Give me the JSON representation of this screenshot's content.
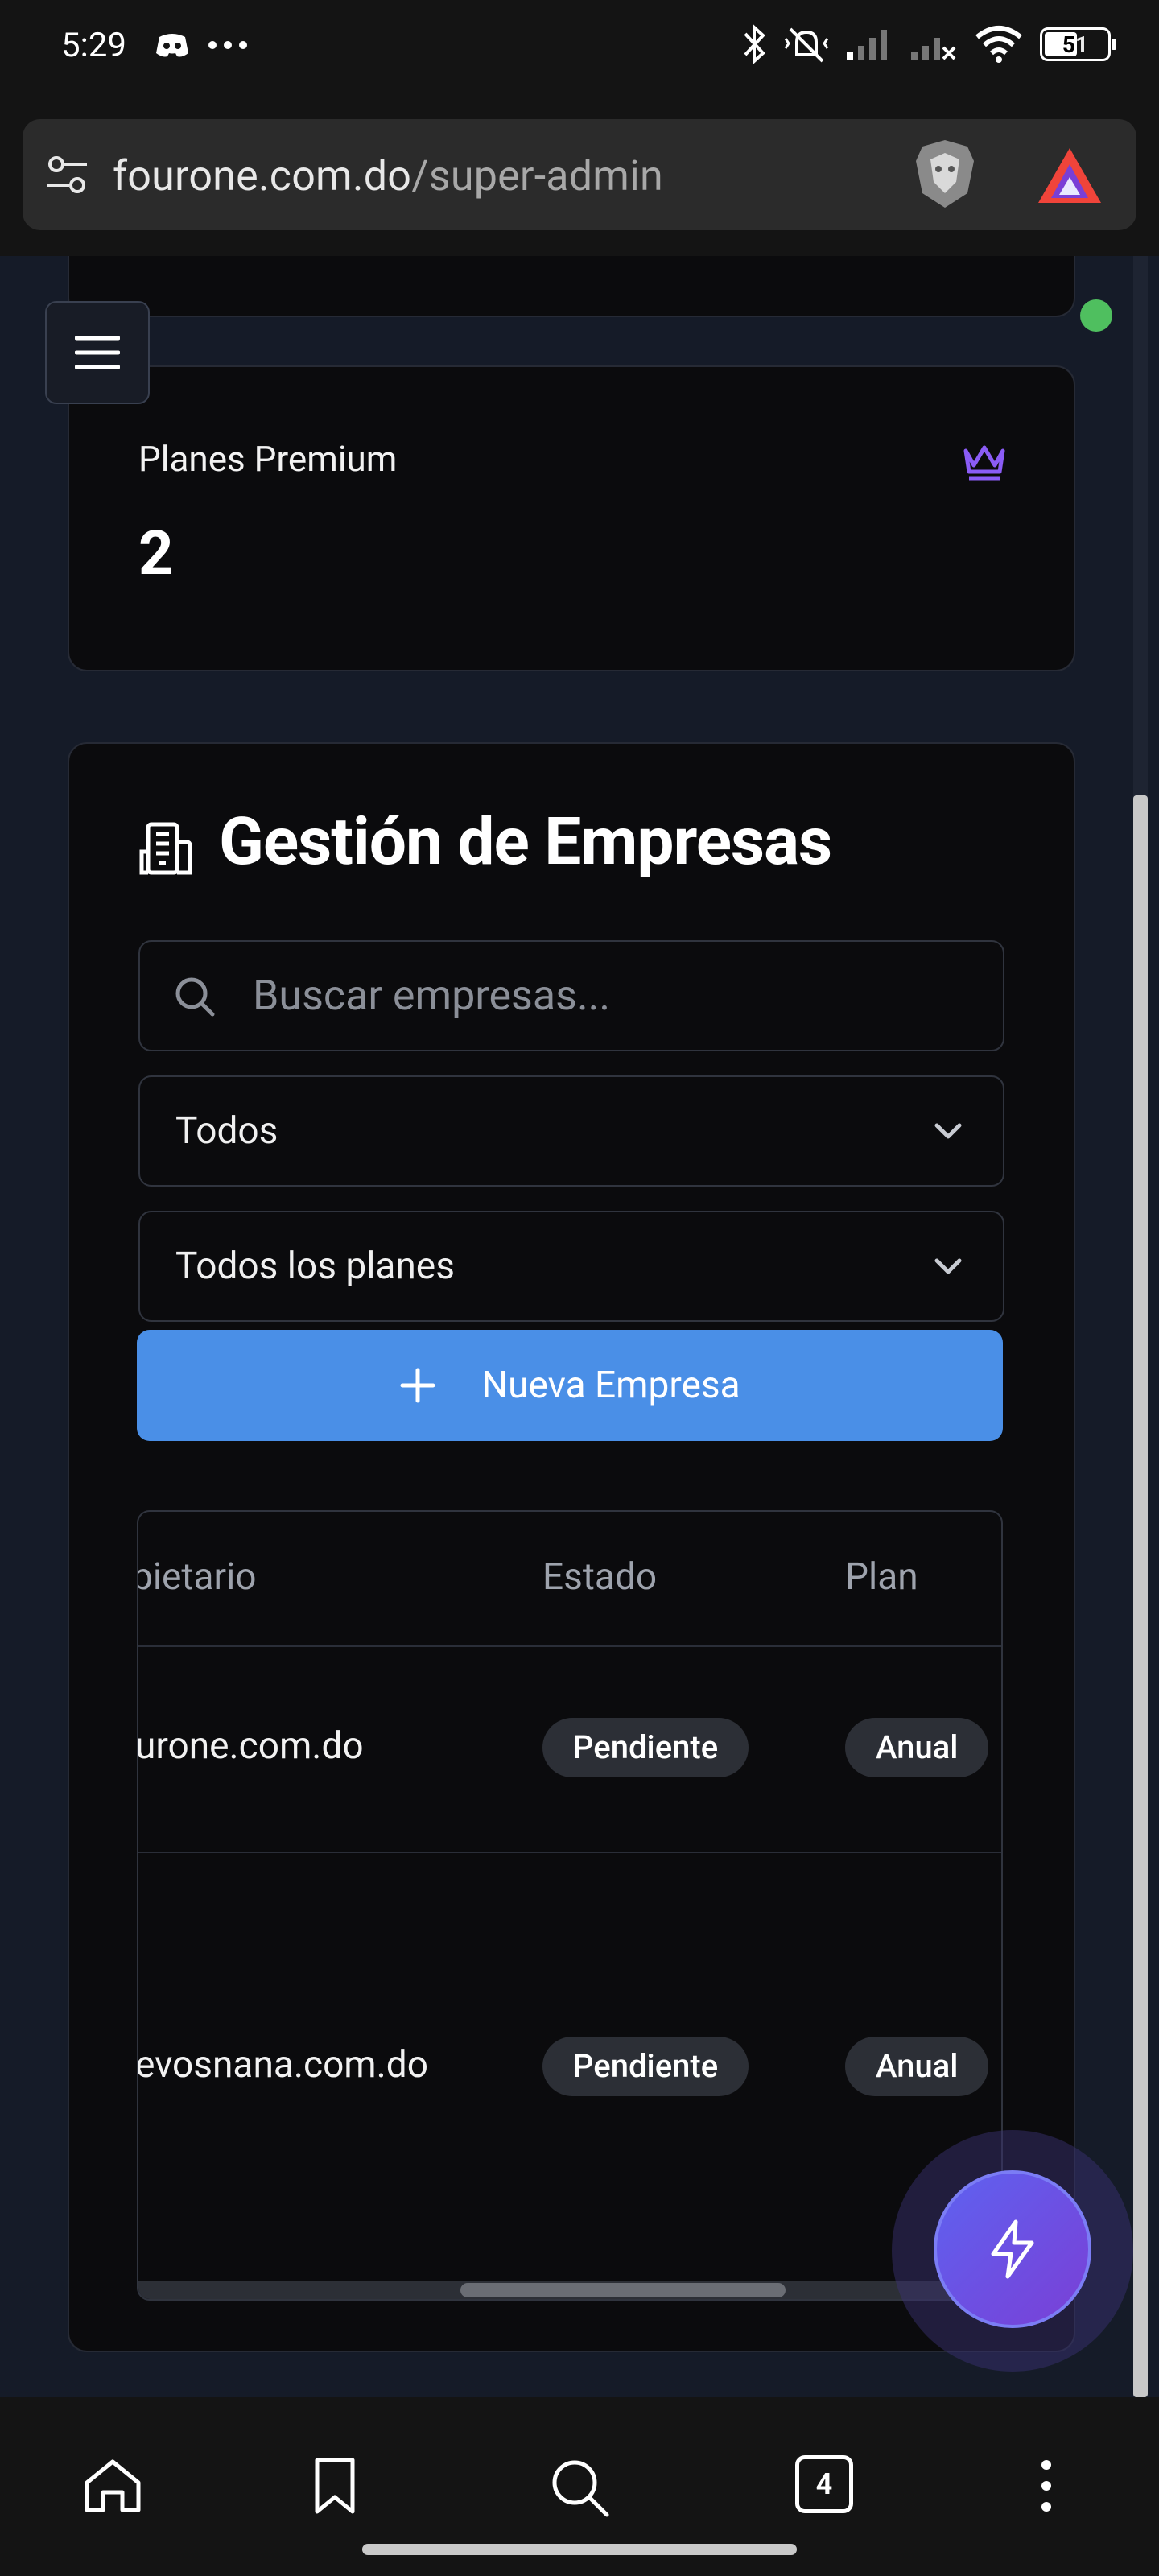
{
  "status_bar": {
    "time": "5:29",
    "battery": "51",
    "icons": [
      "discord-icon",
      "more-dots-icon",
      "bluetooth-icon",
      "mute-vibrate-icon",
      "signal-icon",
      "signal-no-service-icon",
      "wifi-icon",
      "battery-icon"
    ]
  },
  "browser": {
    "url_domain": "fourone.com.do",
    "url_path": "/super-admin",
    "tab_count": "4"
  },
  "stat_card": {
    "label": "Planes Premium",
    "value": "2",
    "icon": "crown-icon"
  },
  "companies": {
    "title": "Gestión de Empresas",
    "search_placeholder": "Buscar empresas...",
    "status_filter": "Todos",
    "plan_filter": "Todos los planes",
    "new_button_label": "Nueva Empresa",
    "table": {
      "headers": [
        "pietario",
        "Estado",
        "Plan"
      ],
      "rows": [
        {
          "owner": "urone.com.do",
          "status": "Pendiente",
          "plan": "Anual"
        },
        {
          "owner": "evosnana.com.do",
          "status": "Pendiente",
          "plan": "Anual"
        }
      ]
    }
  },
  "colors": {
    "accent_blue": "#4a8fe7",
    "crown_purple": "#8b5cf6",
    "online_green": "#4fbf5f",
    "fab_gradient": [
      "#5e62f0",
      "#7a3fd6"
    ]
  }
}
